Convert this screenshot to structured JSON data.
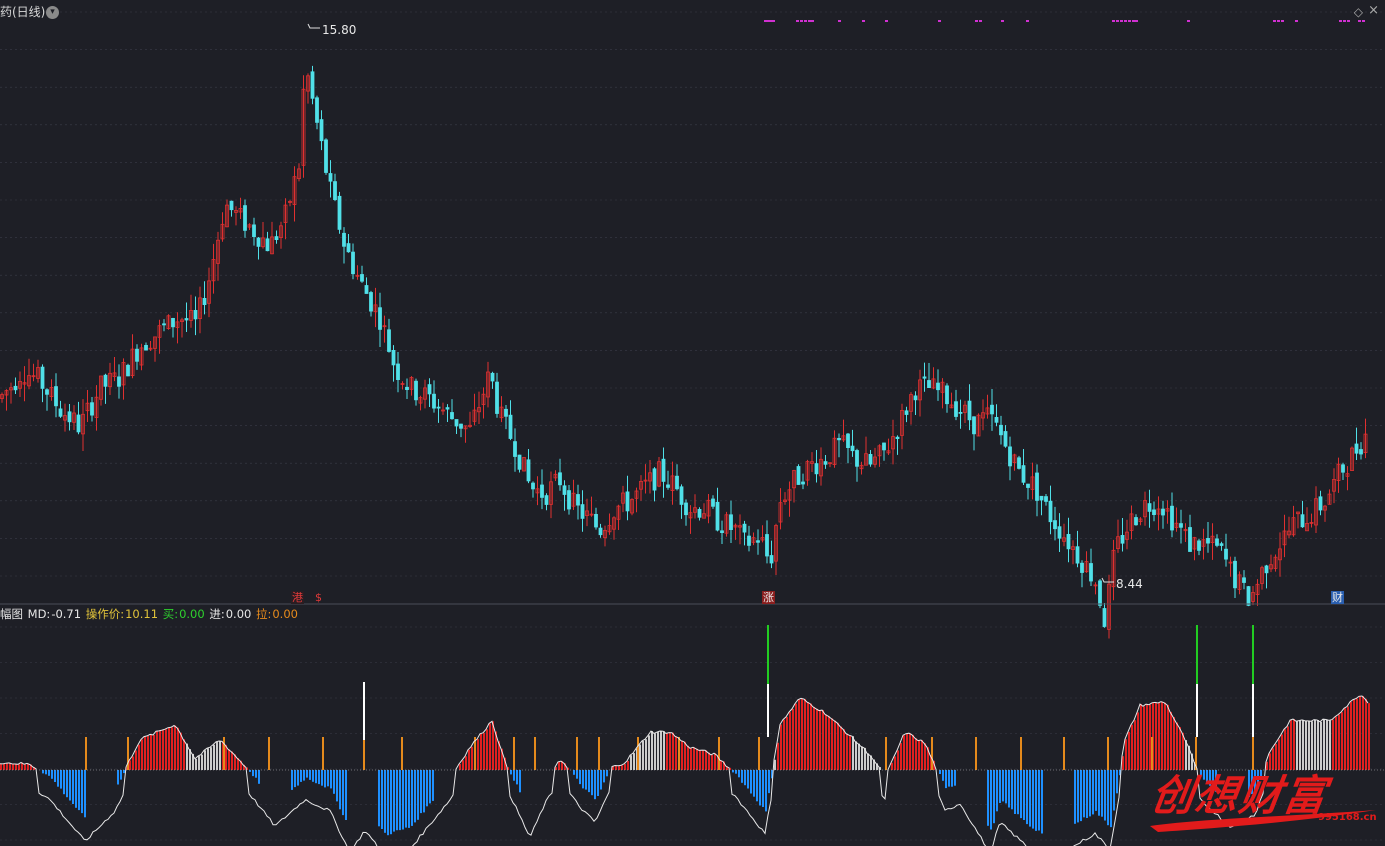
{
  "title": "药(日线)",
  "icons": {
    "chevron": "chevron-down-icon",
    "diamond": "diamond-icon",
    "close": "close-icon"
  },
  "glyphs": {
    "chevron": "▾",
    "diamond": "◇",
    "close": "×"
  },
  "annotations": {
    "high": "15.80",
    "low": "8.44"
  },
  "events": {
    "gang": "港",
    "dollar": "$",
    "zhang": "涨",
    "cai": "财"
  },
  "indicator": {
    "name": "幅图",
    "md_label": "MD:",
    "md_value": "-0.71",
    "price_label": "操作价:",
    "price_value": "10.11",
    "buy_label": "买:",
    "buy_value": "0.00",
    "in_label": "进:",
    "in_value": "0.00",
    "pull_label": "拉:",
    "pull_value": "0.00"
  },
  "brand": {
    "text": "创想财富",
    "url": "995168.cn"
  },
  "colors": {
    "background": "#1e1f26",
    "up": "#e03030",
    "down": "#50e0e8",
    "hist_up": "#e02020",
    "hist_down": "#1e90ff",
    "hist_neutral": "#cccccc",
    "signal_orange": "#e58a1c",
    "signal_green": "#22cc22",
    "signal_white": "#ffffff",
    "magenta_marks": "#d030d0",
    "grid": "#3a3d48",
    "brand": "#e21b1b"
  },
  "chart_data": [
    {
      "type": "candlestick",
      "title": "药(日线)",
      "ylim": [
        8.0,
        16.2
      ],
      "series_nodes": [
        [
          0,
          10.85
        ],
        [
          12,
          11.05
        ],
        [
          22,
          11.25
        ],
        [
          40,
          11.1
        ],
        [
          60,
          10.7
        ],
        [
          80,
          10.45
        ],
        [
          100,
          11.0
        ],
        [
          120,
          11.15
        ],
        [
          140,
          11.6
        ],
        [
          160,
          11.8
        ],
        [
          180,
          12.0
        ],
        [
          196,
          11.9
        ],
        [
          210,
          12.6
        ],
        [
          225,
          13.6
        ],
        [
          240,
          13.4
        ],
        [
          256,
          13.2
        ],
        [
          270,
          13.0
        ],
        [
          285,
          13.4
        ],
        [
          300,
          14.2
        ],
        [
          305,
          15.6
        ],
        [
          316,
          14.8
        ],
        [
          330,
          13.8
        ],
        [
          345,
          13.0
        ],
        [
          360,
          12.5
        ],
        [
          380,
          12.0
        ],
        [
          395,
          11.3
        ],
        [
          410,
          11.0
        ],
        [
          430,
          10.85
        ],
        [
          450,
          10.6
        ],
        [
          470,
          10.4
        ],
        [
          490,
          11.2
        ],
        [
          500,
          10.6
        ],
        [
          515,
          10.2
        ],
        [
          530,
          9.6
        ],
        [
          545,
          9.5
        ],
        [
          560,
          9.7
        ],
        [
          575,
          9.3
        ],
        [
          585,
          9.2
        ],
        [
          600,
          9.0
        ],
        [
          615,
          9.3
        ],
        [
          630,
          9.4
        ],
        [
          645,
          9.6
        ],
        [
          660,
          9.8
        ],
        [
          675,
          9.6
        ],
        [
          690,
          9.3
        ],
        [
          705,
          9.3
        ],
        [
          720,
          9.1
        ],
        [
          735,
          9.0
        ],
        [
          745,
          8.8
        ],
        [
          760,
          8.9
        ],
        [
          770,
          8.5
        ],
        [
          780,
          9.4
        ],
        [
          795,
          9.7
        ],
        [
          810,
          9.9
        ],
        [
          825,
          10.0
        ],
        [
          840,
          10.2
        ],
        [
          855,
          10.0
        ],
        [
          870,
          9.9
        ],
        [
          885,
          10.1
        ],
        [
          900,
          10.5
        ],
        [
          915,
          11.0
        ],
        [
          930,
          11.0
        ],
        [
          945,
          10.9
        ],
        [
          960,
          10.7
        ],
        [
          975,
          10.5
        ],
        [
          990,
          10.6
        ],
        [
          1005,
          10.2
        ],
        [
          1020,
          9.8
        ],
        [
          1035,
          9.6
        ],
        [
          1050,
          9.2
        ],
        [
          1065,
          8.9
        ],
        [
          1080,
          8.6
        ],
        [
          1095,
          8.3
        ],
        [
          1105,
          7.7
        ],
        [
          1115,
          8.7
        ],
        [
          1130,
          9.1
        ],
        [
          1145,
          9.35
        ],
        [
          1160,
          9.4
        ],
        [
          1175,
          9.1
        ],
        [
          1190,
          8.8
        ],
        [
          1205,
          8.8
        ],
        [
          1220,
          8.7
        ],
        [
          1235,
          8.3
        ],
        [
          1250,
          8.0
        ],
        [
          1265,
          8.5
        ],
        [
          1280,
          8.8
        ],
        [
          1295,
          9.1
        ],
        [
          1310,
          9.2
        ],
        [
          1325,
          9.4
        ],
        [
          1340,
          9.8
        ],
        [
          1355,
          10.1
        ],
        [
          1368,
          10.4
        ]
      ],
      "annotations": {
        "high": 15.8,
        "low": 8.44
      }
    },
    {
      "type": "bar",
      "title": "幅图",
      "series": [
        {
          "name": "MD",
          "last": -0.71
        },
        {
          "name": "操作价",
          "last": 10.11
        }
      ],
      "wave_nodes": [
        [
          0,
          0.2
        ],
        [
          30,
          0.15
        ],
        [
          50,
          -0.2
        ],
        [
          85,
          -1.3
        ],
        [
          115,
          -0.5
        ],
        [
          140,
          0.8
        ],
        [
          175,
          1.2
        ],
        [
          195,
          0.3
        ],
        [
          220,
          0.8
        ],
        [
          245,
          0.1
        ],
        [
          275,
          -0.9
        ],
        [
          305,
          -0.2
        ],
        [
          330,
          -0.5
        ],
        [
          350,
          -1.6
        ],
        [
          365,
          -1.0
        ],
        [
          385,
          -1.7
        ],
        [
          410,
          -1.5
        ],
        [
          450,
          -0.2
        ],
        [
          470,
          0.6
        ],
        [
          492,
          1.3
        ],
        [
          505,
          0.2
        ],
        [
          530,
          -1.2
        ],
        [
          545,
          -0.3
        ],
        [
          560,
          0.3
        ],
        [
          580,
          -0.4
        ],
        [
          595,
          -0.8
        ],
        [
          610,
          0.05
        ],
        [
          625,
          0.2
        ],
        [
          650,
          1.0
        ],
        [
          670,
          1.0
        ],
        [
          690,
          0.6
        ],
        [
          715,
          0.4
        ],
        [
          735,
          -0.1
        ],
        [
          765,
          -1.1
        ],
        [
          780,
          1.2
        ],
        [
          800,
          1.9
        ],
        [
          825,
          1.5
        ],
        [
          850,
          0.9
        ],
        [
          870,
          0.4
        ],
        [
          885,
          -0.2
        ],
        [
          905,
          1.0
        ],
        [
          925,
          0.7
        ],
        [
          945,
          -0.5
        ],
        [
          960,
          -0.3
        ],
        [
          990,
          -1.6
        ],
        [
          1000,
          -0.8
        ],
        [
          1030,
          -1.5
        ],
        [
          1060,
          -1.9
        ],
        [
          1075,
          -1.4
        ],
        [
          1095,
          -1.1
        ],
        [
          1110,
          -1.5
        ],
        [
          1125,
          0.8
        ],
        [
          1140,
          1.7
        ],
        [
          1165,
          1.8
        ],
        [
          1185,
          0.8
        ],
        [
          1200,
          -0.2
        ],
        [
          1230,
          -0.9
        ],
        [
          1255,
          -0.6
        ],
        [
          1270,
          0.5
        ],
        [
          1290,
          1.3
        ],
        [
          1330,
          1.3
        ],
        [
          1360,
          2.0
        ],
        [
          1368,
          1.8
        ]
      ],
      "orange_signals": [
        86,
        128,
        224,
        269,
        323,
        364,
        402,
        475,
        514,
        535,
        577,
        599,
        638,
        679,
        719,
        759,
        886,
        932,
        976,
        1021,
        1064,
        1108,
        1152,
        1196,
        1253
      ],
      "white_signals": [
        364,
        768,
        1197,
        1253
      ],
      "green_signals": [
        768,
        1197,
        1253
      ],
      "top_marks": [
        764,
        766,
        768,
        770,
        772,
        796,
        800,
        804,
        808,
        811,
        838,
        862,
        885,
        938,
        975,
        979,
        1001,
        1026,
        1112,
        1116,
        1120,
        1124,
        1128,
        1132,
        1135,
        1187,
        1273,
        1277,
        1281,
        1295,
        1339,
        1343,
        1347,
        1358,
        1362
      ]
    }
  ]
}
